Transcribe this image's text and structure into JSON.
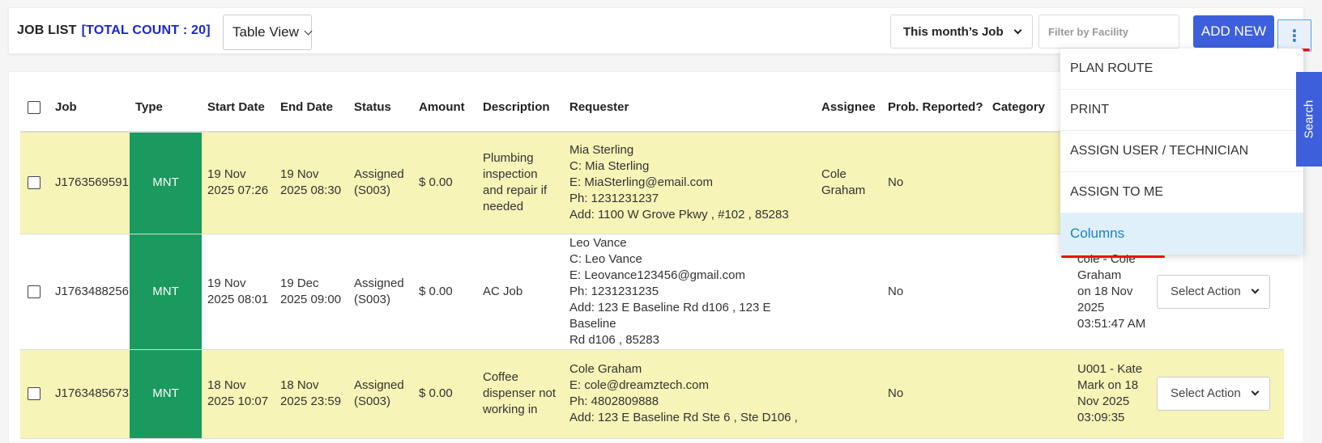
{
  "header": {
    "title": "JOB LIST",
    "count_label": "[TOTAL COUNT : 20]",
    "view_select": "Table View",
    "month_select": "This month’s Job",
    "filter_placeholder": "Filter by Facility",
    "add_button": "ADD NEW",
    "more_icon": "⋮"
  },
  "table": {
    "columns": [
      "Job",
      "Type",
      "Start Date",
      "End Date",
      "Status",
      "Amount",
      "Description",
      "Requester",
      "Assignee",
      "Prob. Reported?",
      "Category"
    ],
    "rows": [
      {
        "job": "J1763569591",
        "type": "MNT",
        "start": [
          "19 Nov",
          "2025 07:26"
        ],
        "end": [
          "19 Nov",
          "2025 08:30"
        ],
        "status": [
          "Assigned",
          "(S003)"
        ],
        "amount": "$ 0.00",
        "description": [
          "Plumbing",
          "inspection",
          "and repair if",
          "needed"
        ],
        "requester": [
          "Mia Sterling",
          "C: Mia Sterling",
          "E: MiaSterling@email.com",
          "Ph: 1231231237",
          "Add: 1100 W Grove Pkwy , #102 , 85283"
        ],
        "assignee": [
          "Cole",
          "Graham"
        ],
        "reported": "No",
        "history": [],
        "action": ""
      },
      {
        "job": "J1763488256",
        "type": "MNT",
        "start": [
          "19 Nov",
          "2025 08:01"
        ],
        "end": [
          "19 Dec",
          "2025 09:00"
        ],
        "status": [
          "Assigned",
          "(S003)"
        ],
        "amount": "$ 0.00",
        "description": [
          "AC Job"
        ],
        "requester": [
          "Leo Vance",
          "C: Leo Vance",
          "E: Leovance123456@gmail.com",
          "Ph: 1231231235",
          "Add: 123 E Baseline Rd d106 , 123 E Baseline",
          "Rd d106 , 85283"
        ],
        "assignee": [],
        "reported": "No",
        "history": [
          "cole - Cole",
          "Graham",
          "on 18 Nov",
          "2025",
          "03:51:47 AM"
        ],
        "action": "Select Action"
      },
      {
        "job": "J1763485673",
        "type": "MNT",
        "start": [
          "18 Nov",
          "2025 10:07"
        ],
        "end": [
          "18 Nov",
          "2025 23:59"
        ],
        "status": [
          "Assigned",
          "(S003)"
        ],
        "amount": "$ 0.00",
        "description": [
          "Coffee",
          "dispenser not",
          "working in"
        ],
        "requester": [
          "Cole Graham",
          "E: cole@dreamztech.com",
          "Ph: 4802809888",
          "Add: 123 E Baseline Rd Ste 6 , Ste D106 ,"
        ],
        "assignee": [],
        "reported": "No",
        "history": [
          "U001 - Kate",
          "Mark on 18",
          "Nov 2025",
          "03:09:35"
        ],
        "action": "Select Action"
      }
    ]
  },
  "menu": {
    "items": [
      "PLAN ROUTE",
      "PRINT",
      "ASSIGN USER / TECHNICIAN",
      "ASSIGN TO ME",
      "Columns"
    ]
  },
  "search_tab": "Search",
  "colors": {
    "primary": "#3d5fdc",
    "type_badge": "#1a9a5e",
    "row_highlight": "#f6f4b6",
    "count": "#1a25d6",
    "annotation": "#e11111"
  }
}
